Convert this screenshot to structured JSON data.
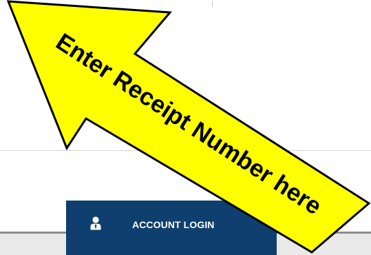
{
  "login": {
    "label": "ACCOUNT LOGIN",
    "icon": "user-icon",
    "bg_color": "#0f3f6e"
  },
  "callout": {
    "text": "Enter Receipt Number here",
    "fill_color": "#ffff00",
    "stroke_color": "#000000"
  }
}
